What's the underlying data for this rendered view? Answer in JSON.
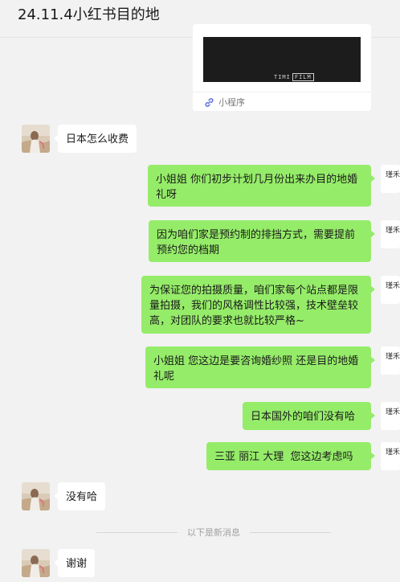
{
  "window": {
    "title": "24.11.4小红书目的地"
  },
  "mini_program_card": {
    "video_logo_text": "TIMI",
    "video_logo_boxed": "FILM",
    "label": "小程序",
    "icon": "link-icon"
  },
  "messages": [
    {
      "side": "in",
      "text": "日本怎么收费"
    },
    {
      "side": "out",
      "text": "小姐姐 你们初步计划几月份出来办目的地婚礼呀"
    },
    {
      "side": "out",
      "text": " 因为咱们家是预约制的排挡方式，需要提前预约您的档期"
    },
    {
      "side": "out",
      "text": "为保证您的拍摄质量，咱们家每个站点都是限量拍摄，我们的风格调性比较强，技术壁垒较高，对团队的要求也就比较严格~"
    },
    {
      "side": "out",
      "text": "小姐姐 您这边是要咨询婚纱照 还是目的地婚礼呢"
    },
    {
      "side": "out",
      "text": "日本国外的咱们没有哈"
    },
    {
      "side": "out",
      "text": "三亚 丽江 大理  您这边考虑吗"
    },
    {
      "side": "in",
      "text": "没有哈"
    },
    {
      "side": "in",
      "text": "谢谢"
    }
  ],
  "new_messages_divider": "以下是新消息",
  "self_avatar_text": "瑾禾映画",
  "colors": {
    "background": "#f2f2f2",
    "outgoing_bubble": "#95ec69",
    "incoming_bubble": "#ffffff",
    "mini_program_icon": "#5b6bd6"
  }
}
